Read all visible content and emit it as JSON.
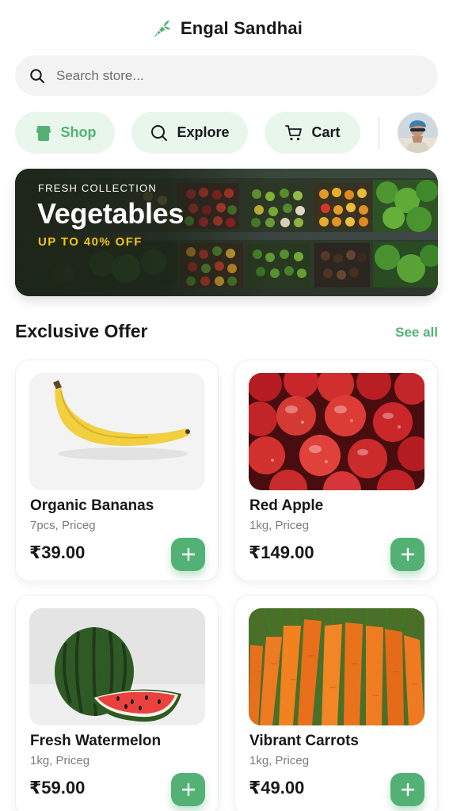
{
  "header": {
    "title": "Engal Sandhai",
    "logo_icon": "carrot-icon"
  },
  "search": {
    "placeholder": "Search store...",
    "value": "",
    "icon": "search-icon"
  },
  "nav": {
    "shop": {
      "label": "Shop",
      "icon": "store-icon",
      "active": true
    },
    "explore": {
      "label": "Explore",
      "icon": "search-icon"
    },
    "cart": {
      "label": "Cart",
      "icon": "cart-icon"
    },
    "avatar": "user-avatar"
  },
  "banner": {
    "kicker": "FRESH COLLECTION",
    "headline": "Vegetables",
    "promo": "UP TO 40% OFF"
  },
  "section": {
    "title": "Exclusive Offer",
    "see_all": "See all"
  },
  "products": [
    {
      "name": "Organic Bananas",
      "meta": "7pcs, Priceg",
      "price": "₹39.00"
    },
    {
      "name": "Red Apple",
      "meta": "1kg, Priceg",
      "price": "₹149.00"
    },
    {
      "name": "Fresh Watermelon",
      "meta": "1kg, Priceg",
      "price": "₹59.00"
    },
    {
      "name": "Vibrant Carrots",
      "meta": "1kg, Priceg",
      "price": "₹49.00"
    }
  ],
  "colors": {
    "brand_green": "#53b175",
    "pill_bg": "#e9f6ec",
    "promo_yellow": "#f3c318",
    "text_dark": "#181818",
    "text_muted": "#7c7c7c"
  }
}
